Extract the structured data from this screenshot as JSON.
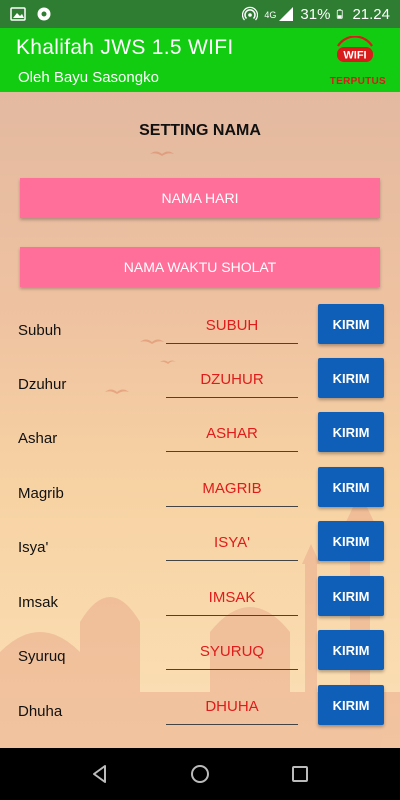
{
  "status_bar": {
    "network": "4G",
    "battery_percent": "31%",
    "time": "21.24"
  },
  "app_bar": {
    "title": "Khalifah JWS  1.5 WIFI",
    "subtitle": "Oleh Bayu Sasongko",
    "wifi_badge": "WIFI",
    "wifi_status": "TERPUTUS"
  },
  "page": {
    "title": "SETTING NAMA",
    "buttons": {
      "day_names": "NAMA HARI",
      "prayer_names": "NAMA WAKTU SHOLAT"
    }
  },
  "rows": [
    {
      "label": "Subuh",
      "value": "SUBUH",
      "button": "KIRIM"
    },
    {
      "label": "Dzuhur",
      "value": "DZUHUR",
      "button": "KIRIM"
    },
    {
      "label": "Ashar",
      "value": "ASHAR",
      "button": "KIRIM"
    },
    {
      "label": "Magrib",
      "value": "MAGRIB",
      "button": "KIRIM"
    },
    {
      "label": "Isya'",
      "value": "ISYA'",
      "button": "KIRIM"
    },
    {
      "label": "Imsak",
      "value": "IMSAK",
      "button": "KIRIM"
    },
    {
      "label": "Syuruq",
      "value": "SYURUQ",
      "button": "KIRIM"
    },
    {
      "label": "Dhuha",
      "value": "DHUHA",
      "button": "KIRIM"
    }
  ],
  "colors": {
    "status_bar": "#2e7d32",
    "app_bar": "#11cc11",
    "pink_button": "#ff6f9a",
    "send_button": "#0f5fb8",
    "field_text": "#e01b1b",
    "wifi_disconnected": "#d81b1b"
  },
  "icons": [
    "image-icon",
    "settings-icon",
    "hotspot-icon",
    "signal-icon",
    "battery-icon",
    "wifi-badge-icon",
    "back-icon",
    "home-icon",
    "recents-icon"
  ]
}
